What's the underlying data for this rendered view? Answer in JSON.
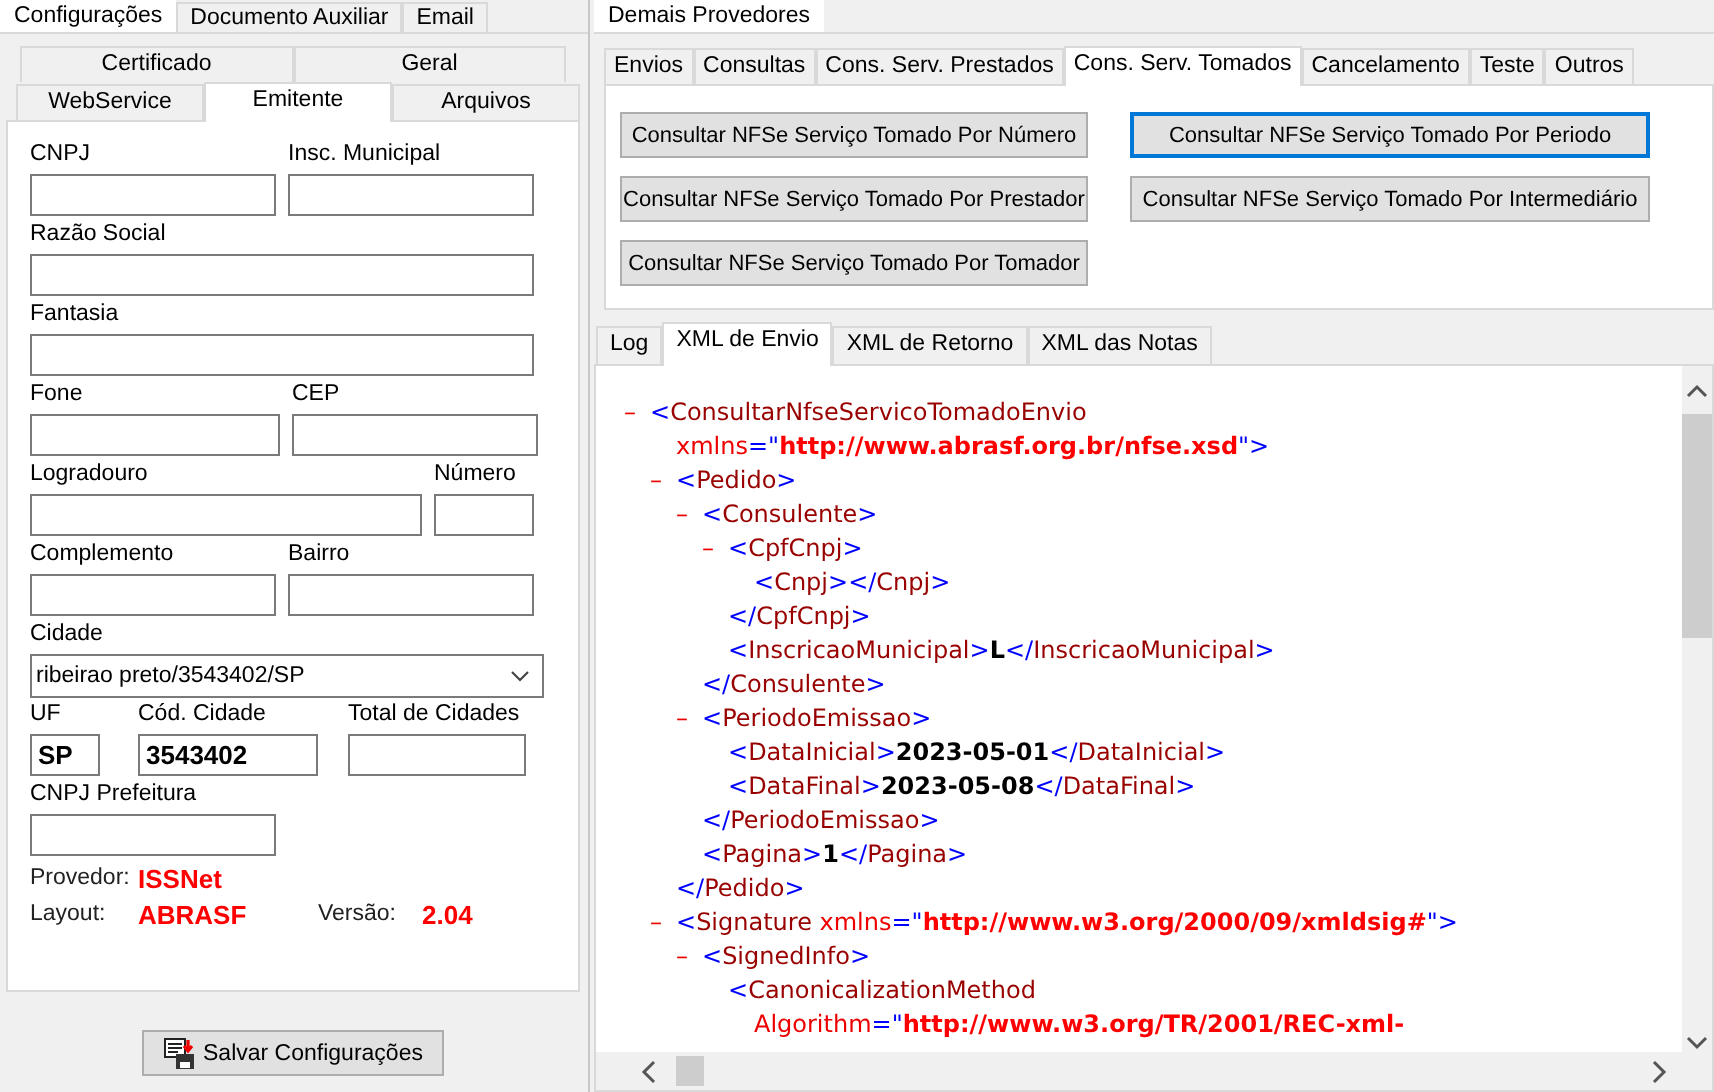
{
  "left": {
    "tabs": [
      {
        "label": "Configurações",
        "selected": true
      },
      {
        "label": "Documento Auxiliar",
        "selected": false
      },
      {
        "label": "Email",
        "selected": false
      }
    ],
    "sub_tabs_row_1": [
      {
        "label": "Certificado",
        "selected": false
      },
      {
        "label": "Geral",
        "selected": false
      }
    ],
    "sub_tabs_row_2": [
      {
        "label": "WebService",
        "selected": false
      },
      {
        "label": "Emitente",
        "selected": true
      },
      {
        "label": "Arquivos",
        "selected": false
      }
    ],
    "fields": [
      {
        "label": "CNPJ"
      },
      {
        "label": "Insc. Municipal"
      },
      {
        "label": "Razão Social"
      },
      {
        "label": "Fantasia"
      },
      {
        "label": "Fone"
      },
      {
        "label": "CEP"
      },
      {
        "label": "Logradouro"
      },
      {
        "label": "Número"
      },
      {
        "label": "Complemento"
      },
      {
        "label": "Bairro"
      }
    ],
    "cidade": {
      "label": "Cidade",
      "value": "ribeirao preto/3543402/SP"
    },
    "codes": [
      {
        "label": "UF",
        "value": "SP"
      },
      {
        "label": "Cód. Cidade",
        "value": "3543402"
      },
      {
        "label": "Total de Cidades"
      }
    ],
    "cnpj_prefeitura": {
      "label": "CNPJ Prefeitura"
    },
    "provedor": {
      "label": "Provedor:",
      "value": "ISSNet"
    },
    "layout": {
      "label": "Layout:",
      "value": "ABRASF"
    },
    "versao": {
      "label": "Versão:",
      "value": "2.04"
    },
    "save_button": "Salvar Configurações"
  },
  "right": {
    "tabs": [
      {
        "label": "Demais Provedores",
        "selected": true
      }
    ],
    "sub_tabs": [
      {
        "label": "Envios",
        "selected": false
      },
      {
        "label": "Consultas",
        "selected": false
      },
      {
        "label": "Cons. Serv. Prestados",
        "selected": false
      },
      {
        "label": "Cons. Serv. Tomados",
        "selected": true
      },
      {
        "label": "Cancelamento",
        "selected": false
      },
      {
        "label": "Teste",
        "selected": false
      },
      {
        "label": "Outros",
        "selected": false
      }
    ],
    "buttons": [
      {
        "label": "Consultar NFSe Serviço Tomado Por Número",
        "focused": false
      },
      {
        "label": "Consultar NFSe Serviço Tomado Por Periodo",
        "focused": true
      },
      {
        "label": "Consultar NFSe Serviço Tomado Por Prestador",
        "focused": false
      },
      {
        "label": "Consultar NFSe Serviço Tomado Por Intermediário",
        "focused": false
      },
      {
        "label": "Consultar NFSe Serviço Tomado Por Tomador",
        "focused": false
      }
    ],
    "log_tabs": [
      {
        "label": "Log",
        "selected": false
      },
      {
        "label": "XML de Envio",
        "selected": true
      },
      {
        "label": "XML de Retorno",
        "selected": false
      },
      {
        "label": "XML das Notas",
        "selected": false
      }
    ],
    "xml": {
      "toggle": "–",
      "lines": [
        [
          {
            "kind": "punct",
            "text": "<"
          },
          {
            "kind": "tag",
            "text": "ConsultarNfseServicoTomadoEnvio"
          }
        ],
        [
          {
            "kind": "attr",
            "text": "xmlns"
          },
          {
            "kind": "punct",
            "text": "=\""
          },
          {
            "kind": "value",
            "text": "http://www.abrasf.org.br/nfse.xsd"
          },
          {
            "kind": "punct",
            "text": "\">"
          }
        ]
      ],
      "children": [
        {
          "toggle": "–",
          "lines": [
            [
              {
                "kind": "punct",
                "text": "<"
              },
              {
                "kind": "tag",
                "text": "Pedido"
              },
              {
                "kind": "punct",
                "text": ">"
              }
            ]
          ],
          "close": [
            {
              "kind": "punct",
              "text": "</"
            },
            {
              "kind": "tag",
              "text": "Pedido"
            },
            {
              "kind": "punct",
              "text": ">"
            }
          ],
          "children": [
            {
              "toggle": "–",
              "lines": [
                [
                  {
                    "kind": "punct",
                    "text": "<"
                  },
                  {
                    "kind": "tag",
                    "text": "Consulente"
                  },
                  {
                    "kind": "punct",
                    "text": ">"
                  }
                ]
              ],
              "close": [
                {
                  "kind": "punct",
                  "text": "</"
                },
                {
                  "kind": "tag",
                  "text": "Consulente"
                },
                {
                  "kind": "punct",
                  "text": ">"
                }
              ],
              "children": [
                {
                  "toggle": "–",
                  "lines": [
                    [
                      {
                        "kind": "punct",
                        "text": "<"
                      },
                      {
                        "kind": "tag",
                        "text": "CpfCnpj"
                      },
                      {
                        "kind": "punct",
                        "text": ">"
                      }
                    ]
                  ],
                  "close": [
                    {
                      "kind": "punct",
                      "text": "</"
                    },
                    {
                      "kind": "tag",
                      "text": "CpfCnpj"
                    },
                    {
                      "kind": "punct",
                      "text": ">"
                    }
                  ],
                  "children": [
                    {
                      "lines": [
                        [
                          {
                            "kind": "punct",
                            "text": "<"
                          },
                          {
                            "kind": "tag",
                            "text": "Cnpj"
                          },
                          {
                            "kind": "punct",
                            "text": ">"
                          },
                          {
                            "kind": "punct",
                            "text": "</"
                          },
                          {
                            "kind": "tag",
                            "text": "Cnpj"
                          },
                          {
                            "kind": "punct",
                            "text": ">"
                          }
                        ]
                      ]
                    }
                  ]
                },
                {
                  "lines": [
                    [
                      {
                        "kind": "punct",
                        "text": "<"
                      },
                      {
                        "kind": "tag",
                        "text": "InscricaoMunicipal"
                      },
                      {
                        "kind": "punct",
                        "text": ">"
                      },
                      {
                        "kind": "text",
                        "text": "L"
                      },
                      {
                        "kind": "punct",
                        "text": "</"
                      },
                      {
                        "kind": "tag",
                        "text": "InscricaoMunicipal"
                      },
                      {
                        "kind": "punct",
                        "text": ">"
                      }
                    ]
                  ]
                }
              ]
            },
            {
              "toggle": "–",
              "lines": [
                [
                  {
                    "kind": "punct",
                    "text": "<"
                  },
                  {
                    "kind": "tag",
                    "text": "PeriodoEmissao"
                  },
                  {
                    "kind": "punct",
                    "text": ">"
                  }
                ]
              ],
              "close": [
                {
                  "kind": "punct",
                  "text": "</"
                },
                {
                  "kind": "tag",
                  "text": "PeriodoEmissao"
                },
                {
                  "kind": "punct",
                  "text": ">"
                }
              ],
              "children": [
                {
                  "lines": [
                    [
                      {
                        "kind": "punct",
                        "text": "<"
                      },
                      {
                        "kind": "tag",
                        "text": "DataInicial"
                      },
                      {
                        "kind": "punct",
                        "text": ">"
                      },
                      {
                        "kind": "text",
                        "text": "2023-05-01"
                      },
                      {
                        "kind": "punct",
                        "text": "</"
                      },
                      {
                        "kind": "tag",
                        "text": "DataInicial"
                      },
                      {
                        "kind": "punct",
                        "text": ">"
                      }
                    ]
                  ]
                },
                {
                  "lines": [
                    [
                      {
                        "kind": "punct",
                        "text": "<"
                      },
                      {
                        "kind": "tag",
                        "text": "DataFinal"
                      },
                      {
                        "kind": "punct",
                        "text": ">"
                      },
                      {
                        "kind": "text",
                        "text": "2023-05-08"
                      },
                      {
                        "kind": "punct",
                        "text": "</"
                      },
                      {
                        "kind": "tag",
                        "text": "DataFinal"
                      },
                      {
                        "kind": "punct",
                        "text": ">"
                      }
                    ]
                  ]
                }
              ]
            },
            {
              "lines": [
                [
                  {
                    "kind": "punct",
                    "text": "<"
                  },
                  {
                    "kind": "tag",
                    "text": "Pagina"
                  },
                  {
                    "kind": "punct",
                    "text": ">"
                  },
                  {
                    "kind": "text",
                    "text": "1"
                  },
                  {
                    "kind": "punct",
                    "text": "</"
                  },
                  {
                    "kind": "tag",
                    "text": "Pagina"
                  },
                  {
                    "kind": "punct",
                    "text": ">"
                  }
                ]
              ]
            }
          ]
        },
        {
          "toggle": "–",
          "lines": [
            [
              {
                "kind": "punct",
                "text": "<"
              },
              {
                "kind": "tag",
                "text": "Signature"
              },
              {
                "kind": "attr",
                "text": " xmlns"
              },
              {
                "kind": "punct",
                "text": "=\""
              },
              {
                "kind": "value",
                "text": "http://www.w3.org/2000/09/xmldsig#"
              },
              {
                "kind": "punct",
                "text": "\">"
              }
            ]
          ],
          "children": [
            {
              "toggle": "–",
              "lines": [
                [
                  {
                    "kind": "punct",
                    "text": "<"
                  },
                  {
                    "kind": "tag",
                    "text": "SignedInfo"
                  },
                  {
                    "kind": "punct",
                    "text": ">"
                  }
                ]
              ],
              "children": [
                {
                  "lines": [
                    [
                      {
                        "kind": "punct",
                        "text": "<"
                      },
                      {
                        "kind": "tag",
                        "text": "CanonicalizationMethod"
                      }
                    ],
                    [
                      {
                        "kind": "attr",
                        "text": "Algorithm"
                      },
                      {
                        "kind": "punct",
                        "text": "=\""
                      },
                      {
                        "kind": "value",
                        "text": "http://www.w3.org/TR/2001/REC-xml-"
                      }
                    ]
                  ]
                }
              ]
            }
          ]
        }
      ]
    }
  }
}
